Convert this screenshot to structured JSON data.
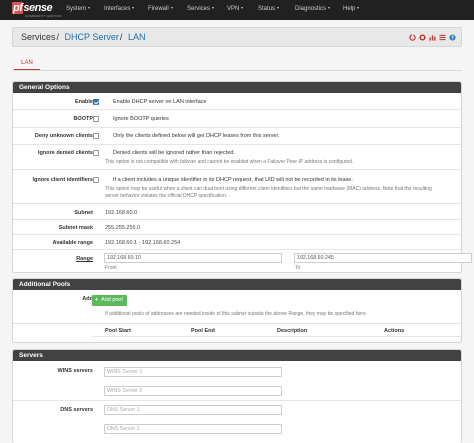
{
  "navbar": {
    "logo_main": "sense",
    "logo_pf": "pf",
    "logo_sub": "COMMUNITY EDITION",
    "menu": [
      "System",
      "Interfaces",
      "Firewall",
      "Services",
      "VPN",
      "Status",
      "Diagnostics",
      "Help"
    ]
  },
  "breadcrumb": {
    "part1": "Services",
    "part2": "DHCP Server",
    "part3": "LAN",
    "sep": "/"
  },
  "header_icons": [
    "circle-icon",
    "stop-icon",
    "chart-icon",
    "list-icon",
    "help-icon"
  ],
  "tabs": [
    {
      "label": "LAN"
    }
  ],
  "general": {
    "title": "General Options",
    "enable_label": "Enable",
    "enable_text": "Enable DHCP server on LAN interface",
    "bootp_label": "BOOTP",
    "bootp_text": "Ignore BOOTP queries",
    "deny_label": "Deny unknown clients",
    "deny_text": "Only the clients defined below will get DHCP leases from this server.",
    "ignore_denied_label": "Ignore denied clients",
    "ignore_denied_text": "Denied clients will be ignored rather than rejected.",
    "ignore_denied_help": "This option is not compatible with failover and cannot be enabled when a Failover Peer IP address is configured.",
    "ignore_id_label": "Ignore client identifiers",
    "ignore_id_text": "If a client includes a unique identifier in its DHCP request, that UID will not be recorded in its lease.",
    "ignore_id_help1": "This option may be useful when a client can dual boot using different client identifiers but the same hardware (MAC) address. Note that the resulting",
    "ignore_id_help2": "server behavior violates the official DHCP specification.",
    "subnet_label": "Subnet",
    "subnet_value": "192.168.60.0",
    "mask_label": "Subnet mask",
    "mask_value": "255.255.255.0",
    "avail_label": "Available range",
    "avail_value": "192.168.60.1 - 192.168.60.254",
    "range_label": "Range",
    "range_from": "192.168.60.10",
    "range_to": "192.168.60.245",
    "from_label": "From",
    "to_label": "To"
  },
  "pools": {
    "title": "Additional Pools",
    "add_label": "Add",
    "add_button": "Add pool",
    "help": "If additional pools of addresses are needed inside of this subnet outside the above Range, they may be specified here.",
    "columns": [
      "Pool Start",
      "Pool End",
      "Description",
      "Actions"
    ]
  },
  "servers": {
    "title": "Servers",
    "wins_label": "WINS servers",
    "wins1_placeholder": "WINS Server 1",
    "wins2_placeholder": "WINS Server 2",
    "dns_label": "DNS servers",
    "dns1_placeholder": "DNS Server 1",
    "dns2_placeholder": "DNS Server 2"
  },
  "colors": {
    "navbar": "#212121",
    "panel_head": "#424242",
    "accent": "#c0392b",
    "link": "#1e6fb8",
    "add_button": "#5cb85c"
  }
}
